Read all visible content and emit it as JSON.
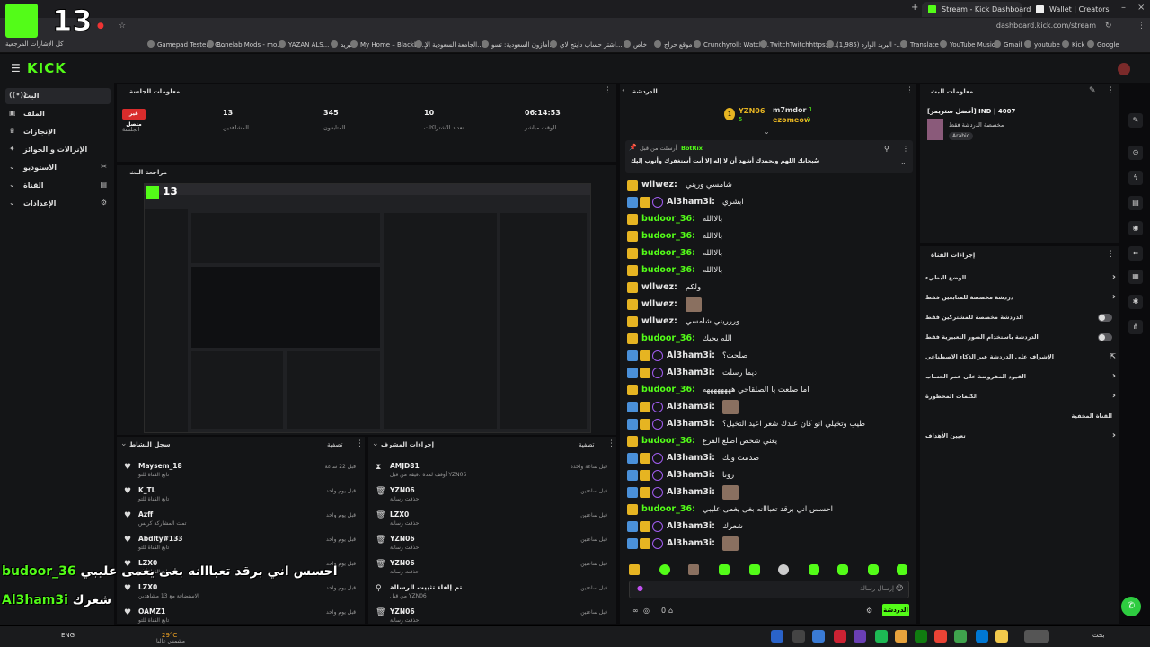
{
  "browser": {
    "tabs": [
      {
        "label": "Stream - Kick Dashboard",
        "active": true
      },
      {
        "label": "Wallet | Creators",
        "active": false
      }
    ],
    "url": "dashboard.kick.com/stream",
    "bookmarks": [
      "كل الإشارات المرجعية",
      "Gamepad Tester - C...",
      "Bonelab Mods - mo...",
      "YAZAN ALS...",
      "البريد",
      "My Home – Blackbo...",
      "الجامعة السعودية الإ...",
      "أمازون السعودية: تسو...",
      "اشتر حساب دايتج لاي...",
      "خاص",
      "موقع حراج",
      "Crunchyroll: Watch...",
      "TwitchTwitchhttps://...",
      "(1,985) البريد الوارد -...",
      "Translate",
      "YouTube Music",
      "Gmail",
      "youtube",
      "Kick",
      "Google"
    ]
  },
  "overlay": {
    "follower_count": "13",
    "chat": [
      {
        "user": "budoor_36",
        "msg": "احسس اني برقد تعبااانه بغى يغمى عليبي"
      },
      {
        "user": "Al3ham3i",
        "msg": "شعرك"
      }
    ]
  },
  "sidebar": {
    "items": [
      {
        "label": "البث",
        "icon": "live-icon",
        "active": true
      },
      {
        "label": "الملف",
        "icon": "profile-icon"
      },
      {
        "label": "الإنجازات",
        "icon": "achievements-icon"
      },
      {
        "label": "الإنزالات و الجوائز",
        "icon": "drops-icon"
      },
      {
        "label": "الاستوديو",
        "icon": "studio-icon"
      },
      {
        "label": "القناة",
        "icon": "channel-icon"
      },
      {
        "label": "الإعدادات",
        "icon": "settings-icon"
      }
    ]
  },
  "session": {
    "title": "معلومات الجلسة",
    "status_badge": "غير متصل",
    "status_label": "الجلسة",
    "stats": [
      {
        "value": "13",
        "label": "المشاهدين"
      },
      {
        "value": "345",
        "label": "المتابعون"
      },
      {
        "value": "10",
        "label": "تعداد الاشتراكات"
      },
      {
        "value": "06:14:53",
        "label": "الوقت مباشر"
      }
    ]
  },
  "preview": {
    "title": "مراجعة البث"
  },
  "activity": {
    "title": "سجل النشاط",
    "filter": "تصفية",
    "rows": [
      {
        "name": "Maysem_18",
        "sub": "تابع القناة للتو",
        "time": "قبل 22 ساعة"
      },
      {
        "name": "K_TL",
        "sub": "تابع القناة للتو",
        "time": "قبل يوم واحد"
      },
      {
        "name": "Azff",
        "sub": "تمت المشاركة كريس",
        "time": "قبل يوم واحد"
      },
      {
        "name": "Abdlty#133",
        "sub": "تابع القناة للتو",
        "time": "قبل يوم واحد"
      },
      {
        "name": "LZX0",
        "sub": "تابع القناة للتو",
        "time": "قبل يوم واحد"
      },
      {
        "name": "LZX0",
        "sub": "الاستضافة مع 13 مشاهدين",
        "time": "قبل يوم واحد"
      },
      {
        "name": "OAMZ1",
        "sub": "تابع القناة للتو",
        "time": "قبل يوم واحد"
      }
    ]
  },
  "mod": {
    "title": "إجراءات المشرف",
    "filter": "تصفية",
    "rows": [
      {
        "name": "AMJD81",
        "sub": "أوقف لمدة دقيقة من قبل YZN06",
        "time": "قبل ساعة واحدة",
        "icon": "timeout-icon"
      },
      {
        "name": "YZN06",
        "sub": "حذفت رسالة",
        "time": "قبل ساعتين",
        "icon": "trash-icon"
      },
      {
        "name": "LZX0",
        "sub": "حذفت رسالة",
        "time": "قبل ساعتين",
        "icon": "trash-icon"
      },
      {
        "name": "YZN06",
        "sub": "حذفت رسالة",
        "time": "قبل ساعتين",
        "icon": "trash-icon"
      },
      {
        "name": "YZN06",
        "sub": "حذفت رسالة",
        "time": "قبل ساعتين",
        "icon": "trash-icon"
      },
      {
        "name": "تم إلغاء تثبيت الرسالة",
        "sub": "من قبل YZN06",
        "time": "قبل ساعتين",
        "icon": "unpin-icon"
      },
      {
        "name": "YZN06",
        "sub": "حذفت رسالة",
        "time": "قبل ساعتين",
        "icon": "trash-icon"
      }
    ]
  },
  "chat": {
    "title": "الدردشة",
    "top_gifters": [
      {
        "name": "YZN06",
        "count": "5"
      },
      {
        "name": "m7mdor",
        "count": "1"
      },
      {
        "name": "ezomeow",
        "count": "1"
      }
    ],
    "pinned": {
      "header": "أرسلت من قبل",
      "user": "BotRix",
      "msg": "سُبحانك اللهم وبحمدك أشهد أن لا إله إلا أنت أستغفرك وأتوب إليك"
    },
    "messages": [
      {
        "user": "wllwez",
        "color": "#e6e6e6",
        "msg": "شامسي وريني",
        "badges": [
          "gold"
        ]
      },
      {
        "user": "Al3ham3i",
        "color": "#e6e6e6",
        "msg": "ابشري",
        "badges": [
          "blue",
          "gold",
          "purple"
        ]
      },
      {
        "user": "budoor_36",
        "color": "#53fc18",
        "msg": "بالاالله",
        "badges": [
          "gold"
        ]
      },
      {
        "user": "budoor_36",
        "color": "#53fc18",
        "msg": "بالاالله",
        "badges": [
          "gold"
        ]
      },
      {
        "user": "budoor_36",
        "color": "#53fc18",
        "msg": "بالاالله",
        "badges": [
          "gold"
        ]
      },
      {
        "user": "budoor_36",
        "color": "#53fc18",
        "msg": "بالاالله",
        "badges": [
          "gold"
        ]
      },
      {
        "user": "wllwez",
        "color": "#e6e6e6",
        "msg": "ولكم",
        "badges": [
          "gold"
        ]
      },
      {
        "user": "wllwez",
        "color": "#e6e6e6",
        "msg": "",
        "badges": [
          "gold"
        ],
        "emote": true
      },
      {
        "user": "wllwez",
        "color": "#e6e6e6",
        "msg": "وررريني شامسي",
        "badges": [
          "gold"
        ]
      },
      {
        "user": "budoor_36",
        "color": "#53fc18",
        "msg": "الله يحيك",
        "badges": [
          "gold"
        ]
      },
      {
        "user": "Al3ham3i",
        "color": "#e6e6e6",
        "msg": "صلحت؟",
        "badges": [
          "blue",
          "gold",
          "purple"
        ]
      },
      {
        "user": "Al3ham3i",
        "color": "#e6e6e6",
        "msg": "ديما رسلت",
        "badges": [
          "blue",
          "gold",
          "purple"
        ]
      },
      {
        "user": "budoor_36",
        "color": "#53fc18",
        "msg": "اما صلعت يا الصلقاحي ههههههههه",
        "badges": [
          "gold"
        ]
      },
      {
        "user": "Al3ham3i",
        "color": "#e6e6e6",
        "msg": "",
        "badges": [
          "blue",
          "gold",
          "purple"
        ],
        "emote": true
      },
      {
        "user": "Al3ham3i",
        "color": "#e6e6e6",
        "msg": "طيب وتخيلي انو كان عندك شعر اعيد التخيل؟",
        "badges": [
          "blue",
          "gold",
          "purple"
        ]
      },
      {
        "user": "budoor_36",
        "color": "#53fc18",
        "msg": "يعني شخص اصلع الفرع",
        "badges": [
          "gold"
        ]
      },
      {
        "user": "Al3ham3i",
        "color": "#e6e6e6",
        "msg": "صدمت ولك",
        "badges": [
          "blue",
          "gold",
          "purple"
        ]
      },
      {
        "user": "Al3ham3i",
        "color": "#e6e6e6",
        "msg": "رونا",
        "badges": [
          "blue",
          "gold",
          "purple"
        ]
      },
      {
        "user": "Al3ham3i",
        "color": "#e6e6e6",
        "msg": "",
        "badges": [
          "blue",
          "gold",
          "purple"
        ],
        "emote": true
      },
      {
        "user": "budoor_36",
        "color": "#53fc18",
        "msg": "احسس اني برقد تعبااانه بغى يغمى عليبي",
        "badges": [
          "gold"
        ]
      },
      {
        "user": "Al3ham3i",
        "color": "#e6e6e6",
        "msg": "شعرك",
        "badges": [
          "blue",
          "gold",
          "purple"
        ]
      },
      {
        "user": "Al3ham3i",
        "color": "#e6e6e6",
        "msg": "",
        "badges": [
          "blue",
          "gold",
          "purple"
        ],
        "emote": true
      }
    ],
    "input_placeholder": "إرسال رسالة",
    "send_label": "الدردشة",
    "kick_points": "0",
    "viewers": "∞"
  },
  "stream_info": {
    "title": "معلومات البث",
    "stream_title": "[أفضل ستريمر]  IND | 4007",
    "category": "مخصصة الدردشة فقط",
    "tag": "Arabic"
  },
  "channel_actions": {
    "title": "إجراءات القناة",
    "items": [
      {
        "label": "الوضع البطيء",
        "control": "chevron"
      },
      {
        "label": "دردشة مخصصة للمتابعين فقط",
        "control": "chevron"
      },
      {
        "label": "الدردشة مخصصة للمشتركين فقط",
        "control": "toggle"
      },
      {
        "label": "الدردشة باستخدام الصور التعبيرية فقط",
        "control": "toggle"
      },
      {
        "label": "الإشراف على الدردشة عبر الذكاء الاصطناعي",
        "control": "external"
      },
      {
        "label": "القيود المفروضة على عمر الحساب",
        "control": "chevron"
      },
      {
        "label": "الكلمات المحظورة",
        "control": "chevron"
      },
      {
        "label": "القناة المخفية",
        "control": "none"
      },
      {
        "label": "تعيين الأهداف",
        "control": "chevron"
      }
    ]
  },
  "taskbar": {
    "lang": "ENG",
    "weather": "29°C",
    "weather_desc": "مشمس غالبا",
    "search": "بحث"
  }
}
